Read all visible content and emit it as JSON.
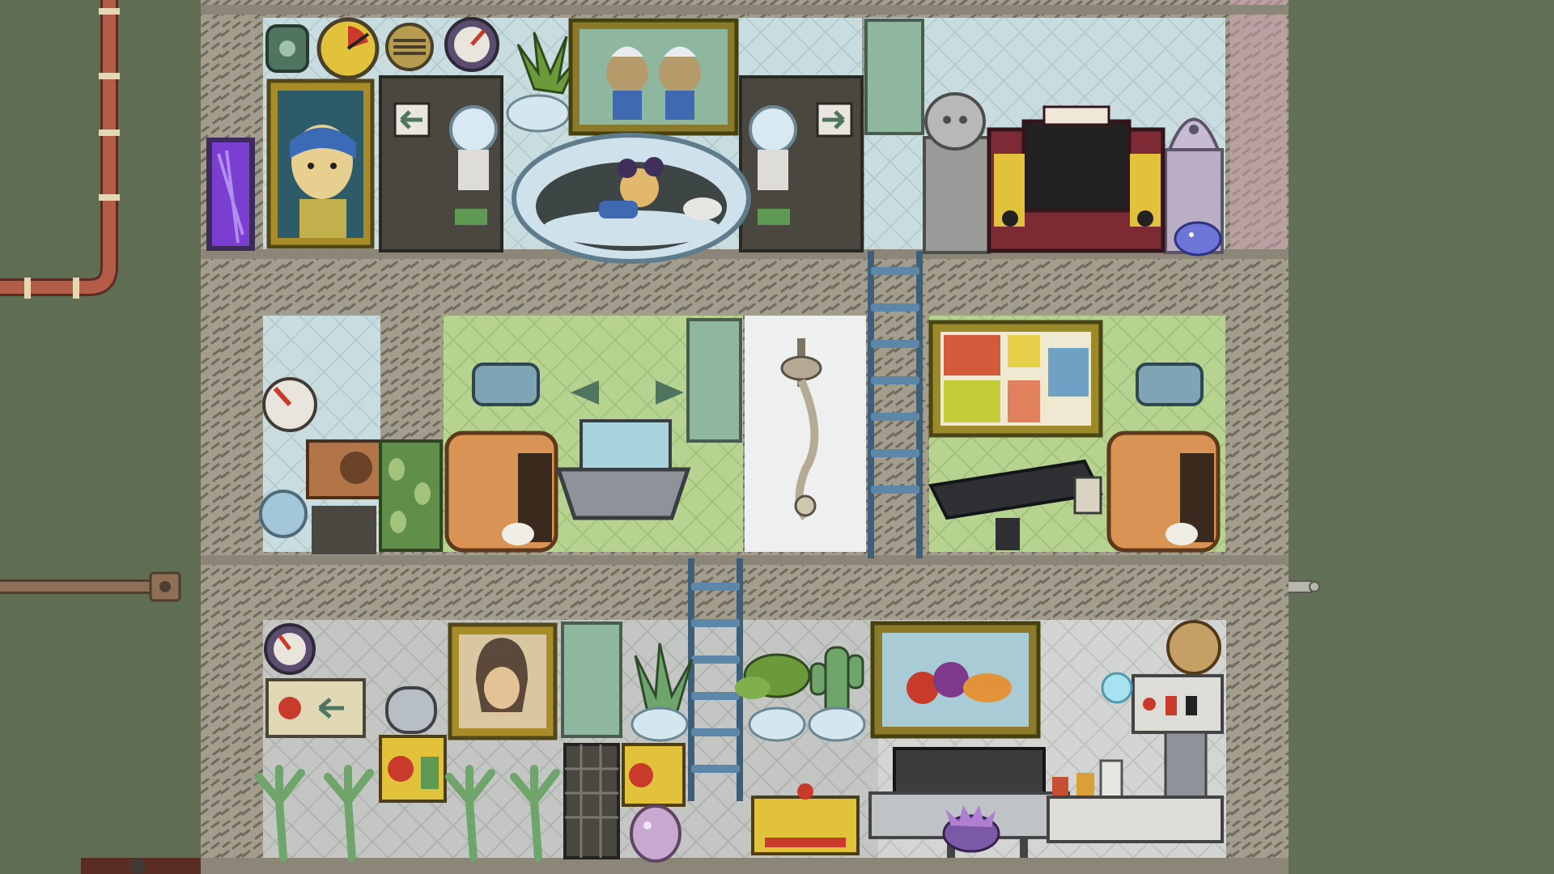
{
  "scene": {
    "title": "",
    "colors": {
      "background": "#5f6e52",
      "tile_frame": "#a39d8d",
      "tile_dark": "#6f6b5f",
      "room_wash": "#c9dde0",
      "room_green": "#b6d48f",
      "room_grey": "#c4c6c4",
      "pipe_red": "#b35c48",
      "pipe_brown": "#8d7056",
      "ladder": "#5d87a8",
      "glass": "#8fb79f",
      "pink_edge": "#cfa3b3",
      "purple_door": "#7a3fd0",
      "accent_red": "#c83b2b",
      "accent_yellow": "#e2c23a",
      "accent_orange": "#d99455"
    },
    "rooms": [
      {
        "name": "barracks-room",
        "icon": "bed-pod-icon"
      },
      {
        "name": "great-hall-room",
        "icon": "arcade-cabinet-icon"
      },
      {
        "name": "washroom-left",
        "icon": "toilet-icon"
      },
      {
        "name": "shower-room",
        "icon": "shower-icon"
      },
      {
        "name": "massage-room",
        "icon": "massage-table-icon"
      },
      {
        "name": "garden-room",
        "icon": "plant-pot-icon"
      },
      {
        "name": "kitchen-room",
        "icon": "espresso-machine-icon"
      }
    ],
    "decor": [
      "portrait-pearl-earring-icon",
      "portrait-duo-icon",
      "portrait-smile-icon",
      "painting-abstract-icon",
      "painting-still-life-icon",
      "statue-icon",
      "statue-purple-icon",
      "duplicant-sleeping-icon",
      "critter-purple-icon",
      "egg-icon"
    ],
    "machines": [
      "pressure-gauge-icon",
      "atmo-suit-dock-icon",
      "wash-basin-icon",
      "oxygen-diffuser-icon",
      "grill-icon",
      "fridge-icon",
      "power-box-icon"
    ]
  }
}
